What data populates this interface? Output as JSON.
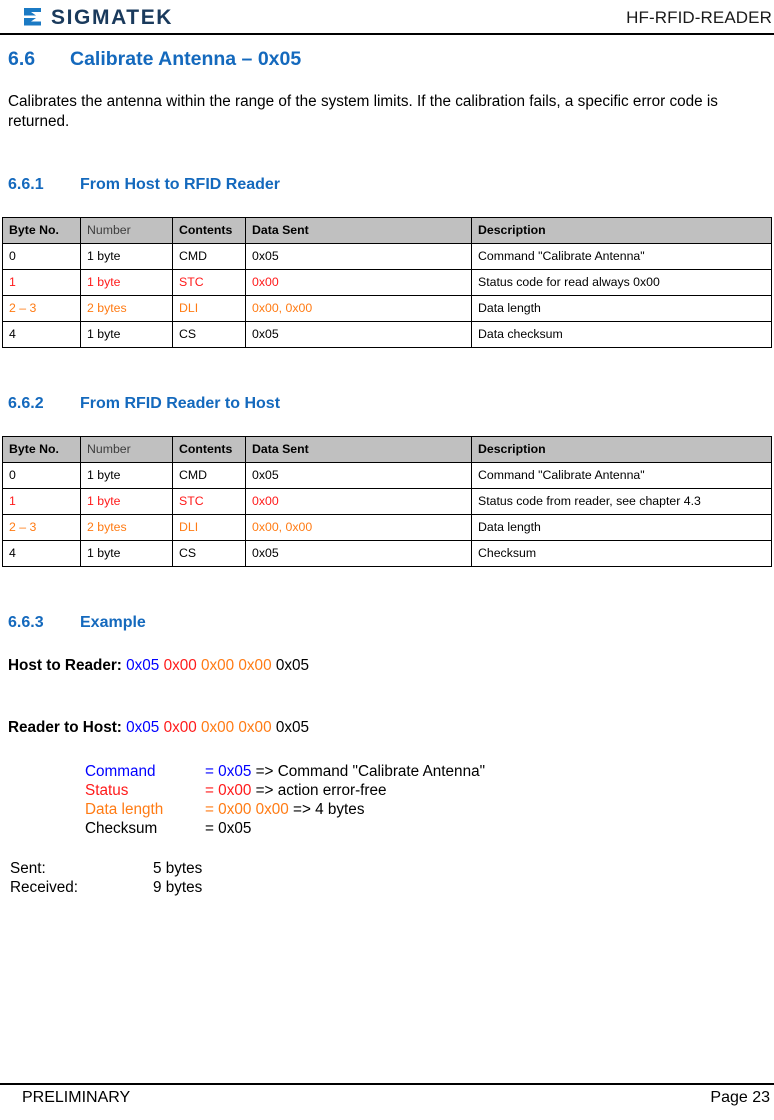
{
  "header": {
    "logo_text": "SIGMATEK",
    "logo_icon": "sigmatek-sigma-logo-icon",
    "document_title": "HF-RFID-READER"
  },
  "section": {
    "number": "6.6",
    "title": "Calibrate Antenna – 0x05",
    "intro": "Calibrates the antenna within the range of the system limits. If the calibration fails, a specific error code is returned."
  },
  "subsection_1": {
    "number": "6.6.1",
    "title": "From Host to RFID Reader",
    "table": {
      "headers": [
        "Byte No.",
        "Number",
        "Contents",
        "Data Sent",
        "Description"
      ],
      "rows": [
        {
          "color": "black",
          "cells": [
            "0",
            "1 byte",
            "CMD",
            "0x05",
            "Command \"Calibrate Antenna\""
          ]
        },
        {
          "color": "red",
          "cells": [
            "1",
            "1 byte",
            "STC",
            "0x00",
            "Status code for read always 0x00"
          ]
        },
        {
          "color": "orange",
          "cells": [
            "2 – 3",
            "2 bytes",
            "DLI",
            "0x00, 0x00",
            "Data length"
          ]
        },
        {
          "color": "black",
          "cells": [
            "4",
            "1 byte",
            "CS",
            "0x05",
            "Data checksum"
          ]
        }
      ]
    }
  },
  "subsection_2": {
    "number": "6.6.2",
    "title": "From RFID Reader to Host",
    "table": {
      "headers": [
        "Byte No.",
        "Number",
        "Contents",
        "Data Sent",
        "Description"
      ],
      "rows": [
        {
          "color": "black",
          "cells": [
            "0",
            "1 byte",
            "CMD",
            "0x05",
            "Command \"Calibrate Antenna\""
          ]
        },
        {
          "color": "red",
          "cells": [
            "1",
            "1 byte",
            "STC",
            "0x00",
            "Status code from reader, see chapter 4.3"
          ]
        },
        {
          "color": "orange",
          "cells": [
            "2 – 3",
            "2 bytes",
            "DLI",
            "0x00, 0x00",
            "Data length"
          ]
        },
        {
          "color": "black",
          "cells": [
            "4",
            "1 byte",
            "CS",
            "0x05",
            "Checksum"
          ]
        }
      ]
    }
  },
  "subsection_3": {
    "number": "6.6.3",
    "title": "Example",
    "host_to_reader": {
      "label": "Host to Reader:",
      "bytes": [
        {
          "text": "0x05",
          "color": "blue"
        },
        {
          "text": "0x00",
          "color": "red"
        },
        {
          "text": "0x00",
          "color": "orange"
        },
        {
          "text": "0x00",
          "color": "orange"
        },
        {
          "text": "0x05",
          "color": "black"
        }
      ]
    },
    "reader_to_host": {
      "label": "Reader to Host:",
      "bytes": [
        {
          "text": "0x05",
          "color": "blue"
        },
        {
          "text": "0x00",
          "color": "red"
        },
        {
          "text": "0x00",
          "color": "orange"
        },
        {
          "text": "0x00",
          "color": "orange"
        },
        {
          "text": "0x05",
          "color": "black"
        }
      ]
    },
    "details": [
      {
        "name": "Command",
        "color": "blue",
        "value": "= 0x05",
        "note": "=> Command \"Calibrate Antenna\""
      },
      {
        "name": "Status",
        "color": "red",
        "value": "= 0x00",
        "note": "=> action error-free"
      },
      {
        "name": "Data length",
        "color": "orange",
        "value": "=  0x00 0x00",
        "note": "=> 4 bytes"
      },
      {
        "name": "Checksum",
        "color": "black",
        "value": "= 0x05",
        "note": ""
      }
    ],
    "totals": [
      {
        "label": "Sent:",
        "value": "5 bytes"
      },
      {
        "label": "Received:",
        "value": "9 bytes"
      }
    ]
  },
  "footer": {
    "status": "PRELIMINARY",
    "page": "Page 23"
  },
  "colors": {
    "heading_blue": "#1469bd",
    "logo_navy": "#1a3a5c",
    "logo_blue": "#1b7ac4",
    "table_header_bg": "#c0c0c0",
    "red": "#ff1a1a",
    "orange": "#ff7b14",
    "blue": "#0000ff"
  }
}
